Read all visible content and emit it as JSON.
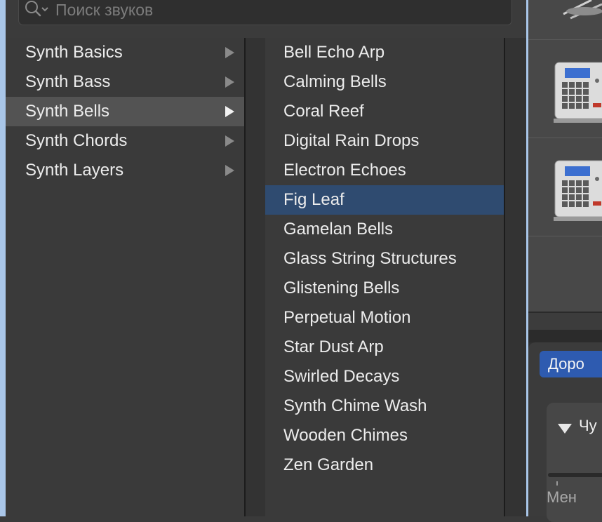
{
  "search": {
    "placeholder": "Поиск звуков"
  },
  "categories": [
    {
      "label": "Synth Basics"
    },
    {
      "label": "Synth Bass"
    },
    {
      "label": "Synth Bells"
    },
    {
      "label": "Synth Chords"
    },
    {
      "label": "Synth Layers"
    }
  ],
  "patches": [
    {
      "label": "Bell Echo Arp"
    },
    {
      "label": "Calming Bells"
    },
    {
      "label": "Coral Reef"
    },
    {
      "label": "Digital Rain Drops"
    },
    {
      "label": "Electron Echoes"
    },
    {
      "label": "Fig Leaf"
    },
    {
      "label": "Gamelan Bells"
    },
    {
      "label": "Glass String Structures"
    },
    {
      "label": "Glistening Bells"
    },
    {
      "label": "Perpetual Motion"
    },
    {
      "label": "Star Dust Arp"
    },
    {
      "label": "Swirled Decays"
    },
    {
      "label": "Synth Chime Wash"
    },
    {
      "label": "Wooden Chimes"
    },
    {
      "label": "Zen Garden"
    }
  ],
  "inspector": {
    "tab_label": "Доро",
    "section_title": "Чу",
    "slider_min_label": "Мен"
  },
  "colors": {
    "selection": "#2f4b70",
    "parent_selection": "#535353",
    "tab_accent": "#2e5bb0",
    "window_edge": "#a9c6e8"
  }
}
